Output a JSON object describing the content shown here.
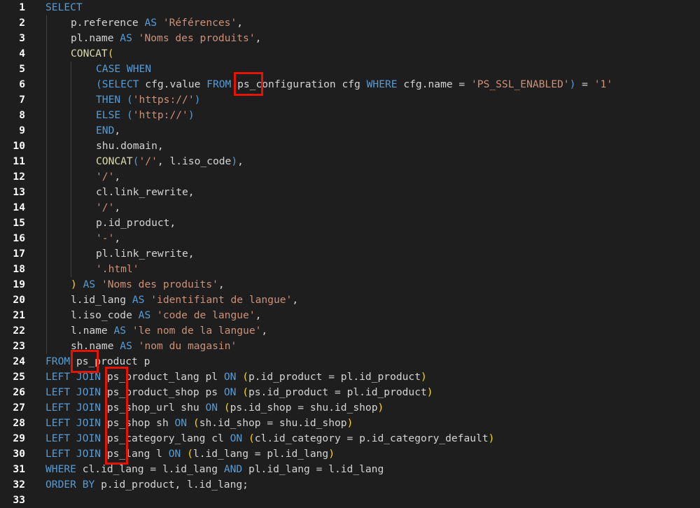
{
  "editor": {
    "lines": [
      {
        "n": "1",
        "indent": 0,
        "tokens": [
          {
            "t": "kw",
            "v": "SELECT"
          }
        ]
      },
      {
        "n": "2",
        "indent": 1,
        "tokens": [
          {
            "t": "id",
            "v": "p.reference "
          },
          {
            "t": "kw",
            "v": "AS"
          },
          {
            "t": "id",
            "v": " "
          },
          {
            "t": "str",
            "v": "'Références'"
          },
          {
            "t": "pn",
            "v": ","
          }
        ]
      },
      {
        "n": "3",
        "indent": 1,
        "tokens": [
          {
            "t": "id",
            "v": "pl.name "
          },
          {
            "t": "kw",
            "v": "AS"
          },
          {
            "t": "id",
            "v": " "
          },
          {
            "t": "str",
            "v": "'Noms des produits'"
          },
          {
            "t": "pn",
            "v": ","
          }
        ]
      },
      {
        "n": "4",
        "indent": 1,
        "tokens": [
          {
            "t": "fn",
            "v": "CONCAT"
          },
          {
            "t": "paren",
            "v": "("
          }
        ]
      },
      {
        "n": "5",
        "indent": 2,
        "tokens": [
          {
            "t": "kw",
            "v": "CASE WHEN"
          }
        ]
      },
      {
        "n": "6",
        "indent": 2,
        "tokens": [
          {
            "t": "kw",
            "v": "("
          },
          {
            "t": "kw",
            "v": "SELECT"
          },
          {
            "t": "id",
            "v": " cfg.value "
          },
          {
            "t": "kw",
            "v": "FROM"
          },
          {
            "t": "id",
            "v": " ps_configuration cfg "
          },
          {
            "t": "kw",
            "v": "WHERE"
          },
          {
            "t": "id",
            "v": " cfg.name = "
          },
          {
            "t": "str",
            "v": "'PS_SSL_ENABLED'"
          },
          {
            "t": "kw",
            "v": ")"
          },
          {
            "t": "id",
            "v": " = "
          },
          {
            "t": "str",
            "v": "'1'"
          }
        ]
      },
      {
        "n": "7",
        "indent": 2,
        "tokens": [
          {
            "t": "kw",
            "v": "THEN"
          },
          {
            "t": "id",
            "v": " "
          },
          {
            "t": "kw",
            "v": "("
          },
          {
            "t": "str",
            "v": "'https://'"
          },
          {
            "t": "kw",
            "v": ")"
          }
        ]
      },
      {
        "n": "8",
        "indent": 2,
        "tokens": [
          {
            "t": "kw",
            "v": "ELSE"
          },
          {
            "t": "id",
            "v": " "
          },
          {
            "t": "kw",
            "v": "("
          },
          {
            "t": "str",
            "v": "'http://'"
          },
          {
            "t": "kw",
            "v": ")"
          }
        ]
      },
      {
        "n": "9",
        "indent": 2,
        "tokens": [
          {
            "t": "kw",
            "v": "END"
          },
          {
            "t": "pn",
            "v": ","
          }
        ]
      },
      {
        "n": "10",
        "indent": 2,
        "tokens": [
          {
            "t": "id",
            "v": "shu.domain,"
          }
        ]
      },
      {
        "n": "11",
        "indent": 2,
        "tokens": [
          {
            "t": "fn",
            "v": "CONCAT"
          },
          {
            "t": "kw",
            "v": "("
          },
          {
            "t": "str",
            "v": "'/'"
          },
          {
            "t": "pn",
            "v": ", l.iso_code"
          },
          {
            "t": "kw",
            "v": ")"
          },
          {
            "t": "pn",
            "v": ","
          }
        ]
      },
      {
        "n": "12",
        "indent": 2,
        "tokens": [
          {
            "t": "str",
            "v": "'/'"
          },
          {
            "t": "pn",
            "v": ","
          }
        ]
      },
      {
        "n": "13",
        "indent": 2,
        "tokens": [
          {
            "t": "id",
            "v": "cl.link_rewrite,"
          }
        ]
      },
      {
        "n": "14",
        "indent": 2,
        "tokens": [
          {
            "t": "str",
            "v": "'/'"
          },
          {
            "t": "pn",
            "v": ","
          }
        ]
      },
      {
        "n": "15",
        "indent": 2,
        "tokens": [
          {
            "t": "id",
            "v": "p.id_product,"
          }
        ]
      },
      {
        "n": "16",
        "indent": 2,
        "tokens": [
          {
            "t": "str",
            "v": "'-'"
          },
          {
            "t": "pn",
            "v": ","
          }
        ]
      },
      {
        "n": "17",
        "indent": 2,
        "tokens": [
          {
            "t": "id",
            "v": "pl.link_rewrite,"
          }
        ]
      },
      {
        "n": "18",
        "indent": 2,
        "tokens": [
          {
            "t": "str",
            "v": "'.html'"
          }
        ]
      },
      {
        "n": "19",
        "indent": 1,
        "tokens": [
          {
            "t": "paren",
            "v": ")"
          },
          {
            "t": "id",
            "v": " "
          },
          {
            "t": "kw",
            "v": "AS"
          },
          {
            "t": "id",
            "v": " "
          },
          {
            "t": "str",
            "v": "'Noms des produits'"
          },
          {
            "t": "pn",
            "v": ","
          }
        ]
      },
      {
        "n": "20",
        "indent": 1,
        "tokens": [
          {
            "t": "id",
            "v": "l.id_lang "
          },
          {
            "t": "kw",
            "v": "AS"
          },
          {
            "t": "id",
            "v": " "
          },
          {
            "t": "str",
            "v": "'identifiant de langue'"
          },
          {
            "t": "pn",
            "v": ","
          }
        ]
      },
      {
        "n": "21",
        "indent": 1,
        "tokens": [
          {
            "t": "id",
            "v": "l.iso_code "
          },
          {
            "t": "kw",
            "v": "AS"
          },
          {
            "t": "id",
            "v": " "
          },
          {
            "t": "str",
            "v": "'code de langue'"
          },
          {
            "t": "pn",
            "v": ","
          }
        ]
      },
      {
        "n": "22",
        "indent": 1,
        "tokens": [
          {
            "t": "id",
            "v": "l.name "
          },
          {
            "t": "kw",
            "v": "AS"
          },
          {
            "t": "id",
            "v": " "
          },
          {
            "t": "str",
            "v": "'le nom de la langue'"
          },
          {
            "t": "pn",
            "v": ","
          }
        ]
      },
      {
        "n": "23",
        "indent": 1,
        "tokens": [
          {
            "t": "id",
            "v": "sh.name "
          },
          {
            "t": "kw",
            "v": "AS"
          },
          {
            "t": "id",
            "v": " "
          },
          {
            "t": "str",
            "v": "'nom du magasin'"
          }
        ]
      },
      {
        "n": "24",
        "indent": 0,
        "tokens": [
          {
            "t": "kw",
            "v": "FROM"
          },
          {
            "t": "id",
            "v": " ps_product p"
          }
        ]
      },
      {
        "n": "25",
        "indent": 0,
        "tokens": [
          {
            "t": "kw",
            "v": "LEFT JOIN"
          },
          {
            "t": "id",
            "v": " ps_product_lang pl "
          },
          {
            "t": "kw",
            "v": "ON"
          },
          {
            "t": "id",
            "v": " "
          },
          {
            "t": "paren",
            "v": "("
          },
          {
            "t": "id",
            "v": "p.id_product = pl.id_product"
          },
          {
            "t": "paren",
            "v": ")"
          }
        ]
      },
      {
        "n": "26",
        "indent": 0,
        "tokens": [
          {
            "t": "kw",
            "v": "LEFT JOIN"
          },
          {
            "t": "id",
            "v": " ps_product_shop ps "
          },
          {
            "t": "kw",
            "v": "ON"
          },
          {
            "t": "id",
            "v": " "
          },
          {
            "t": "paren",
            "v": "("
          },
          {
            "t": "id",
            "v": "ps.id_product = pl.id_product"
          },
          {
            "t": "paren",
            "v": ")"
          }
        ]
      },
      {
        "n": "27",
        "indent": 0,
        "tokens": [
          {
            "t": "kw",
            "v": "LEFT JOIN"
          },
          {
            "t": "id",
            "v": " ps_shop_url shu "
          },
          {
            "t": "kw",
            "v": "ON"
          },
          {
            "t": "id",
            "v": " "
          },
          {
            "t": "paren",
            "v": "("
          },
          {
            "t": "id",
            "v": "ps.id_shop = shu.id_shop"
          },
          {
            "t": "paren",
            "v": ")"
          }
        ]
      },
      {
        "n": "28",
        "indent": 0,
        "tokens": [
          {
            "t": "kw",
            "v": "LEFT JOIN"
          },
          {
            "t": "id",
            "v": " ps_shop sh "
          },
          {
            "t": "kw",
            "v": "ON"
          },
          {
            "t": "id",
            "v": " "
          },
          {
            "t": "paren",
            "v": "("
          },
          {
            "t": "id",
            "v": "sh.id_shop = shu.id_shop"
          },
          {
            "t": "paren",
            "v": ")"
          }
        ]
      },
      {
        "n": "29",
        "indent": 0,
        "tokens": [
          {
            "t": "kw",
            "v": "LEFT JOIN"
          },
          {
            "t": "id",
            "v": " ps_category_lang cl "
          },
          {
            "t": "kw",
            "v": "ON"
          },
          {
            "t": "id",
            "v": " "
          },
          {
            "t": "paren",
            "v": "("
          },
          {
            "t": "id",
            "v": "cl.id_category = p.id_category_default"
          },
          {
            "t": "paren",
            "v": ")"
          }
        ]
      },
      {
        "n": "30",
        "indent": 0,
        "tokens": [
          {
            "t": "kw",
            "v": "LEFT JOIN"
          },
          {
            "t": "id",
            "v": " ps_lang l "
          },
          {
            "t": "kw",
            "v": "ON"
          },
          {
            "t": "id",
            "v": " "
          },
          {
            "t": "paren",
            "v": "("
          },
          {
            "t": "id",
            "v": "l.id_lang = pl.id_lang"
          },
          {
            "t": "paren",
            "v": ")"
          }
        ]
      },
      {
        "n": "31",
        "indent": 0,
        "tokens": [
          {
            "t": "kw",
            "v": "WHERE"
          },
          {
            "t": "id",
            "v": " cl.id_lang = l.id_lang "
          },
          {
            "t": "kw",
            "v": "AND"
          },
          {
            "t": "id",
            "v": " pl.id_lang = l.id_lang"
          }
        ]
      },
      {
        "n": "32",
        "indent": 0,
        "tokens": [
          {
            "t": "kw",
            "v": "ORDER BY"
          },
          {
            "t": "id",
            "v": " p.id_product, l.id_lang;"
          }
        ]
      },
      {
        "n": "33",
        "indent": 0,
        "tokens": []
      }
    ]
  },
  "highlight_color": "#e51400"
}
